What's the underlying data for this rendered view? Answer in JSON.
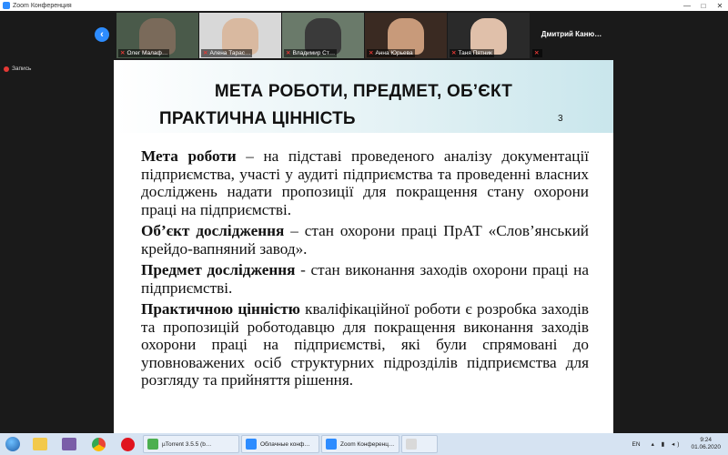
{
  "window": {
    "title": "Zoom Конференция",
    "minimize": "—",
    "maximize": "□",
    "close": "✕"
  },
  "participants": [
    {
      "name": "Олег Малаф…",
      "face": "#7a6a5a",
      "bg": "#4a5a4a"
    },
    {
      "name": "Алена Тарас…",
      "face": "#d9b9a0",
      "bg": "#d8d8d8"
    },
    {
      "name": "Владимир Ст…",
      "face": "#3a3a3a",
      "bg": "#6a7a6a"
    },
    {
      "name": "Анна Юрьева",
      "face": "#c89a7a",
      "bg": "#3a2a22"
    },
    {
      "name": "Таня Пятник",
      "face": "#e0c0aa",
      "bg": "#2a2a2a"
    },
    {
      "name": "",
      "label": "Дмитрий Каню…"
    }
  ],
  "recording": {
    "label": "Запись"
  },
  "slide": {
    "title_line1": "МЕТА РОБОТИ, ПРЕДМЕТ, ОБ’ЄКТ",
    "title_line2": "ПРАКТИЧНА ЦІННІСТЬ",
    "number": "3",
    "paragraphs": [
      {
        "term": "Мета роботи",
        "text": " – на підставі проведеного аналізу документації підприємства, участі у аудиті підприємства та проведенні власних досліджень надати пропозиції для покращення стану охорони праці на підприємстві."
      },
      {
        "term": "Об’єкт дослідження",
        "text": " – стан охорони праці ПрАТ «Слов’янський крейдо-вапняний завод»."
      },
      {
        "term": "Предмет дослідження",
        "text": " - стан виконання заходів охорони праці на підприємстві."
      },
      {
        "term": "Практичною цінністю",
        "text": " кваліфікаційної роботи є розробка заходів та пропозицій роботодавцю для покращення виконання заходів охорони праці на підприємстві, які були спрямовані до уповноважених осіб структурних підрозділів підприємства для розгляду та прийняття рішення."
      }
    ]
  },
  "taskbar": {
    "tasks": [
      {
        "label": "µTorrent 3.5.5  (b…",
        "color": "#4caf50"
      },
      {
        "label": "Облачные конф…",
        "color": "#2d8cff"
      },
      {
        "label": "Zoom Конференц…",
        "color": "#2d8cff"
      },
      {
        "label": "",
        "color": "#d9d9d9"
      }
    ],
    "lang": "EN",
    "time": "9:24",
    "date": "01.06.2020"
  }
}
